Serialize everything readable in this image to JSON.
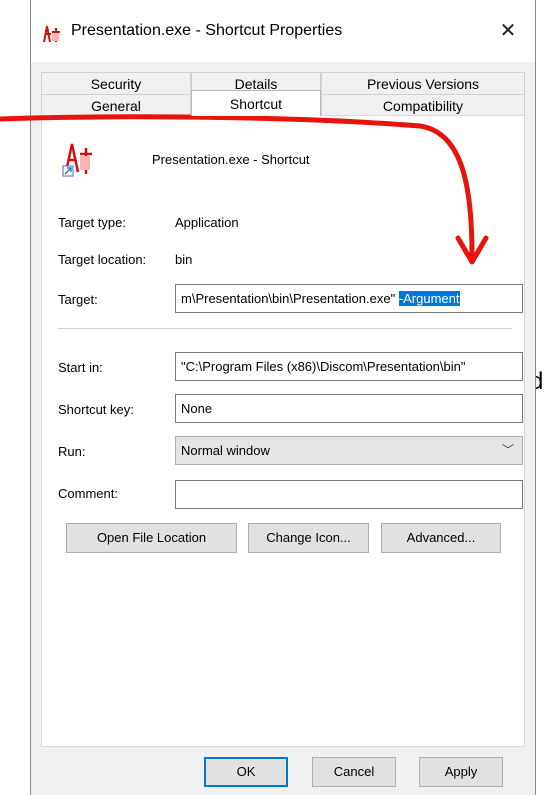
{
  "side_fragment": "d",
  "titlebar": {
    "title": "Presentation.exe - Shortcut Properties",
    "close_glyph": "✕"
  },
  "tabs": {
    "row1": [
      "Security",
      "Details",
      "Previous Versions"
    ],
    "row2": [
      "General",
      "Shortcut",
      "Compatibility"
    ],
    "active": "Shortcut"
  },
  "shortcut": {
    "file_name": "Presentation.exe - Shortcut",
    "target_type_label": "Target type:",
    "target_type_value": "Application",
    "target_location_label": "Target location:",
    "target_location_value": "bin",
    "target_label": "Target:",
    "target_value_plain": "m\\Presentation\\bin\\Presentation.exe\" ",
    "target_value_selected": "-Argument",
    "start_in_label": "Start in:",
    "start_in_value": "\"C:\\Program Files (x86)\\Discom\\Presentation\\bin\"",
    "shortcut_key_label": "Shortcut key:",
    "shortcut_key_value": "None",
    "run_label": "Run:",
    "run_value": "Normal window",
    "comment_label": "Comment:",
    "comment_value": ""
  },
  "actions": {
    "open_file_location": "Open File Location",
    "change_icon": "Change Icon...",
    "advanced": "Advanced..."
  },
  "footer": {
    "ok": "OK",
    "cancel": "Cancel",
    "apply": "Apply"
  },
  "colors": {
    "selection": "#0078d7",
    "annotation_arrow": "#e8140c"
  }
}
